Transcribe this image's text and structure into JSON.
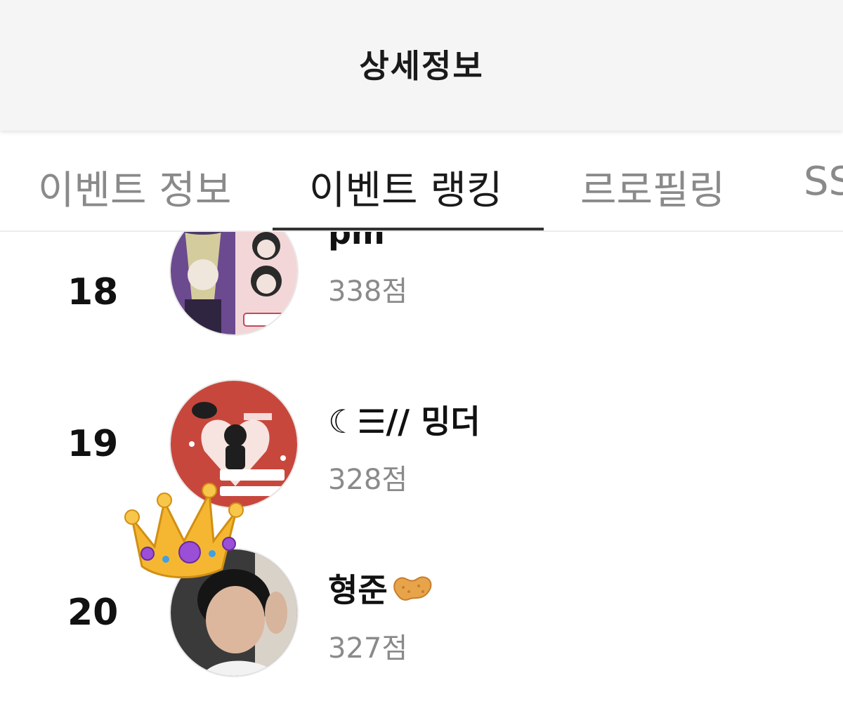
{
  "header": {
    "title": "상세정보"
  },
  "tabs": [
    {
      "label": "이벤트 정보",
      "active": false
    },
    {
      "label": "이벤트 랭킹",
      "active": true
    },
    {
      "label": "르로필링",
      "active": false
    },
    {
      "label": "SS",
      "active": false
    }
  ],
  "ranking": [
    {
      "rank": "18",
      "name": "pm",
      "score": "338점"
    },
    {
      "rank": "19",
      "name": "☾☰// 밍더",
      "score": "328점"
    },
    {
      "rank": "20",
      "name": "형준",
      "score": "327점",
      "name_emoji": "peanut-icon",
      "badge": "crown-icon"
    }
  ],
  "colors": {
    "header_bg": "#f5f5f5",
    "active_tab": "#1a1a1a",
    "inactive_tab": "#8a8a8a",
    "indicator": "#333333",
    "score_text": "#8a8a8a"
  }
}
